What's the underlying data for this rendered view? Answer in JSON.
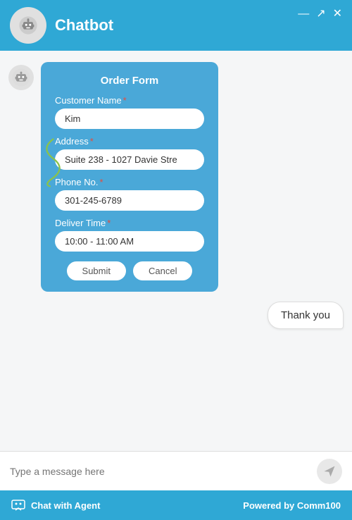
{
  "header": {
    "title": "Chatbot",
    "controls": {
      "minimize": "—",
      "maximize": "↗",
      "close": "✕"
    }
  },
  "form": {
    "title": "Order Form",
    "fields": [
      {
        "label": "Customer Name",
        "required": true,
        "value": "Kim",
        "placeholder": ""
      },
      {
        "label": "Address",
        "required": true,
        "value": "Suite 238 - 1027 Davie Stre",
        "placeholder": ""
      },
      {
        "label": "Phone No.",
        "required": true,
        "value": "301-245-6789",
        "placeholder": ""
      },
      {
        "label": "Deliver Time",
        "required": true,
        "value": "10:00 - 11:00 AM",
        "placeholder": ""
      }
    ],
    "submit_label": "Submit",
    "cancel_label": "Cancel"
  },
  "user_message": "Thank you",
  "input": {
    "placeholder": "Type a message here"
  },
  "footer": {
    "agent_label": "Chat with Agent",
    "powered_label": "Powered by Comm100"
  }
}
